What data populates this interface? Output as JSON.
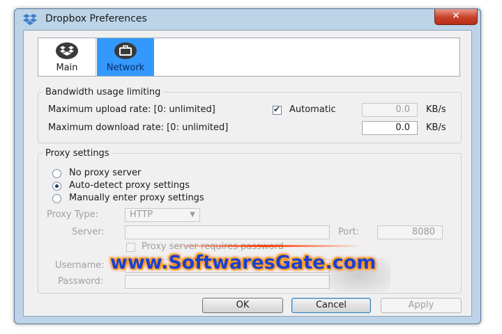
{
  "window": {
    "title": "Dropbox Preferences",
    "close_glyph": "✕"
  },
  "tabs": [
    {
      "label": "Main",
      "icon": "dropbox-box-icon"
    },
    {
      "label": "Network",
      "icon": "network-briefcase-icon",
      "selected": true
    }
  ],
  "bandwidth": {
    "group_title": "Bandwidth usage limiting",
    "upload_label": "Maximum upload rate: [0: unlimited]",
    "automatic_label": "Automatic",
    "automatic_checked": true,
    "upload_value": "0.0",
    "upload_unit": "KB/s",
    "download_label": "Maximum download rate: [0: unlimited]",
    "download_value": "0.0",
    "download_unit": "KB/s"
  },
  "proxy": {
    "group_title": "Proxy settings",
    "options": [
      {
        "label": "No proxy server",
        "checked": false
      },
      {
        "label": "Auto-detect proxy settings",
        "checked": true
      },
      {
        "label": "Manually enter proxy settings",
        "checked": false
      }
    ],
    "type_label": "Proxy Type:",
    "type_value": "HTTP",
    "server_label": "Server:",
    "server_value": "",
    "port_label": "Port:",
    "port_value": "8080",
    "requires_password_label": "Proxy server requires password",
    "username_label": "Username:",
    "password_label": "Password:"
  },
  "buttons": {
    "ok": "OK",
    "cancel": "Cancel",
    "apply": "Apply"
  },
  "watermark": {
    "text": "www.SoftwaresGate.com"
  },
  "colors": {
    "selected_tab": "#3399ff",
    "title_bar": "#bcd3e8",
    "close_button": "#c7402a",
    "watermark": "#1c3fd0"
  }
}
